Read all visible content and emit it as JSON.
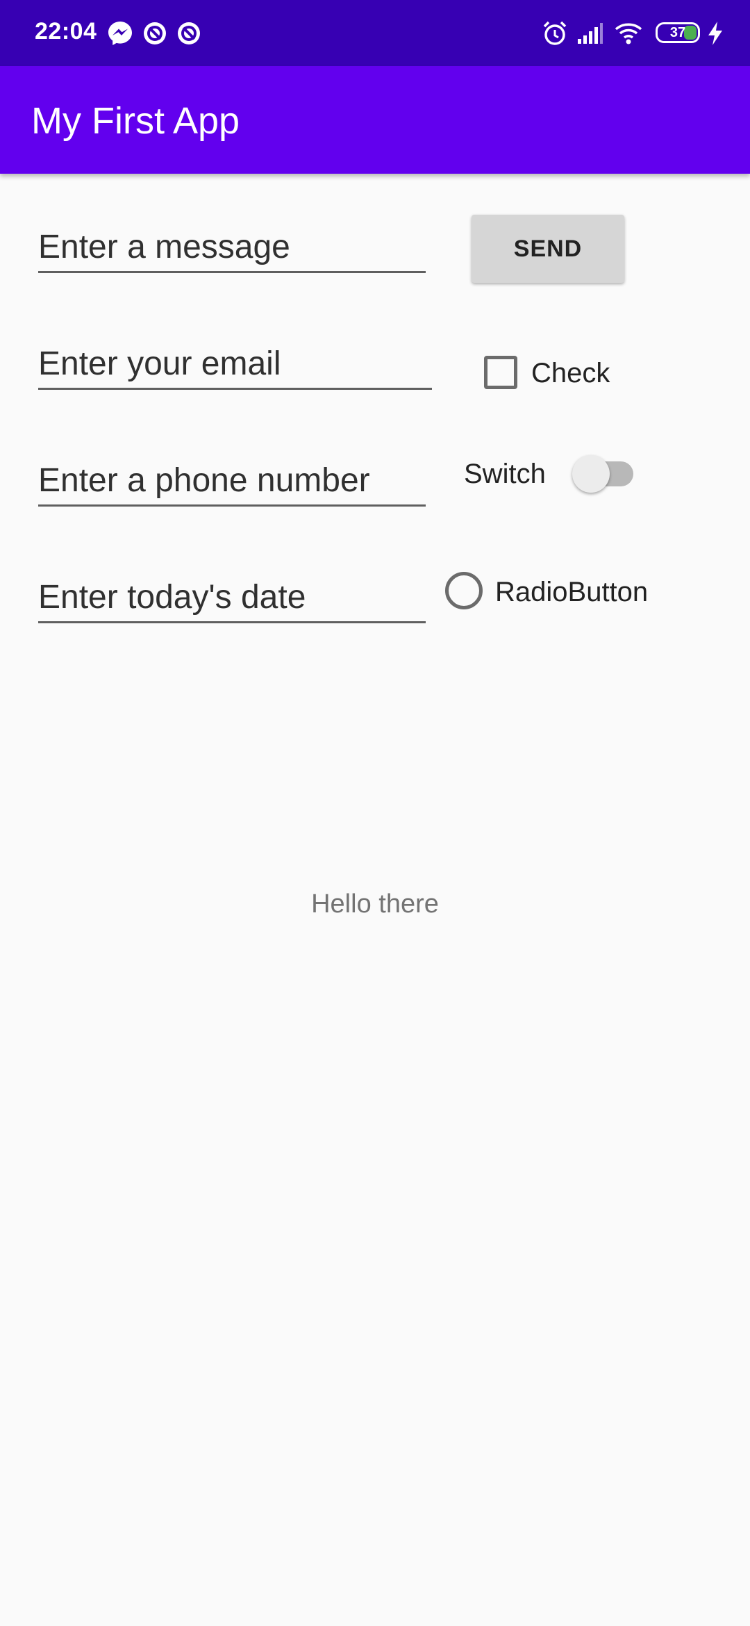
{
  "status_bar": {
    "time": "22:04",
    "battery_level": "37",
    "icons": [
      "messenger-icon",
      "app-notification-icon",
      "app-notification-icon",
      "alarm-icon",
      "signal-icon",
      "wifi-icon",
      "battery-icon",
      "charging-icon"
    ],
    "background_color": "#3700b3"
  },
  "app_bar": {
    "title": "My First App",
    "background_color": "#6200ee"
  },
  "form": {
    "message_placeholder": "Enter a message",
    "message_value": "",
    "send_label": "SEND",
    "email_placeholder": "Enter your email",
    "email_value": "",
    "checkbox_label": "Check",
    "checkbox_checked": false,
    "phone_placeholder": "Enter a phone number",
    "phone_value": "",
    "switch_label": "Switch",
    "switch_on": false,
    "date_placeholder": "Enter today's date",
    "date_value": "",
    "radio_label": "RadioButton",
    "radio_selected": false
  },
  "content": {
    "hello_text": "Hello there"
  }
}
